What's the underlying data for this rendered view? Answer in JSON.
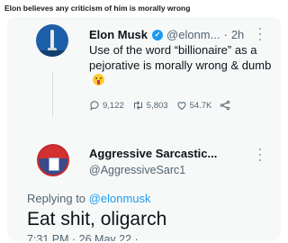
{
  "post": {
    "title": "Elon believes any criticism of him is morally wrong"
  },
  "original_tweet": {
    "display_name": "Elon Musk",
    "handle": "@elonm...",
    "separator": "·",
    "time": "2h",
    "text": "Use of the word “billionaire” as a pejorative is morally wrong & dumb",
    "emoji": "tongue-out-face-icon",
    "replies": "9,122",
    "retweets": "5,803",
    "likes": "54.7K"
  },
  "reply_tweet": {
    "display_name": "Aggressive Sarcastic...",
    "handle": "@AggressiveSarc1",
    "replying_prefix": "Replying to",
    "replying_to": "@elonmusk",
    "text": "Eat shit, oligarch",
    "timestamp": "7:31 PM · 26 May 22 ·"
  },
  "colors": {
    "accent": "#1d9bf0",
    "secondary_text": "#536471",
    "primary_text": "#0f1419",
    "card_background": "#f7f9f9"
  }
}
